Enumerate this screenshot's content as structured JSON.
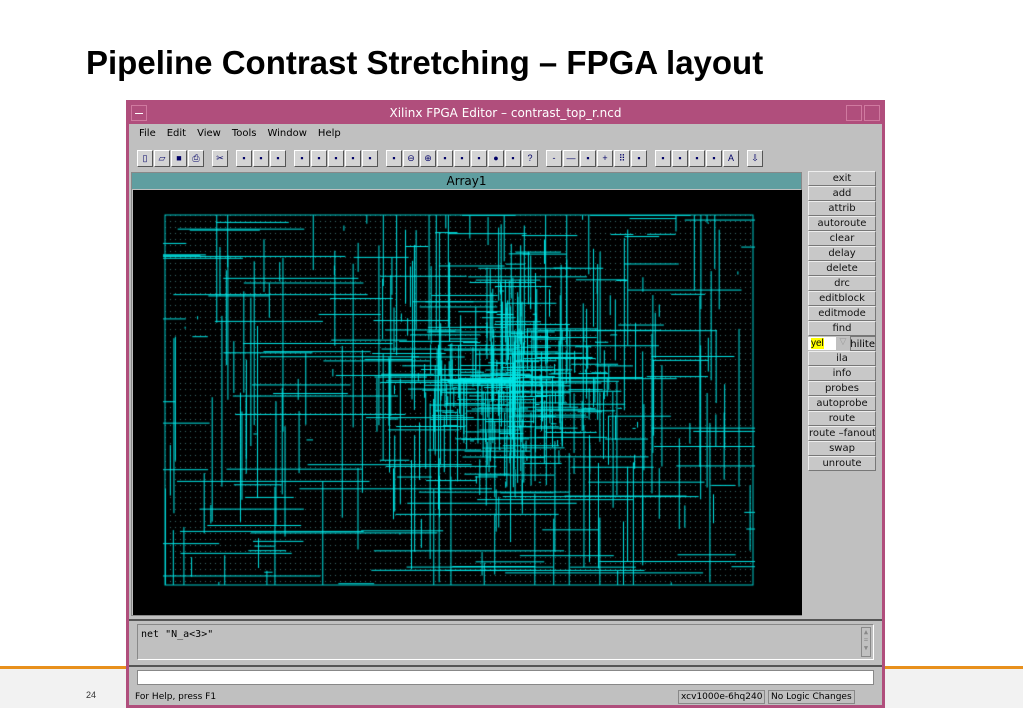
{
  "slide": {
    "title": "Pipeline Contrast Stretching – FPGA layout",
    "page_number": "24"
  },
  "window": {
    "title": "Xilinx FPGA Editor – contrast_top_r.ncd"
  },
  "menu": [
    "File",
    "Edit",
    "View",
    "Tools",
    "Window",
    "Help"
  ],
  "toolbar": [
    [
      "new-icon",
      "open-icon",
      "save-icon",
      "print-icon"
    ],
    [
      "cut-icon"
    ],
    [
      "list-icon",
      "list2-icon",
      "properties-icon"
    ],
    [
      "array-icon",
      "list-view-icon",
      "table-icon",
      "grid-icon",
      "copy-icon"
    ],
    [
      "zoom-fit-icon",
      "zoom-out-icon",
      "zoom-in-icon",
      "zoom-area-icon",
      "zoom-select-icon",
      "refresh-icon",
      "stop-icon",
      "tool-icon",
      "help-icon"
    ],
    [
      "minus-icon",
      "line-icon",
      "bracket-icon",
      "pin-icon",
      "grid-toggle-icon",
      "component-icon"
    ],
    [
      "net-icon",
      "hierarchy-icon",
      "crossing-icon",
      "block-icon",
      "text-icon"
    ],
    [
      "download-icon"
    ]
  ],
  "array_window": {
    "title": "Array1"
  },
  "side_buttons_top": [
    "exit",
    "add",
    "attrib",
    "autoroute",
    "clear",
    "delay",
    "delete",
    "drc",
    "editblock",
    "editmode",
    "find"
  ],
  "hilite": {
    "color": "yel",
    "label": "hilite"
  },
  "side_buttons_bottom": [
    "ila",
    "info",
    "probes",
    "autoprobe",
    "route",
    "route –fanout",
    "swap",
    "unroute"
  ],
  "console": {
    "text": "net \"N_a<3>\""
  },
  "command_input": {
    "value": ""
  },
  "status": {
    "help": "For Help, press F1",
    "device": "xcv1000e-6hq240",
    "changes": "No Logic Changes"
  },
  "colors": {
    "title_bar": "#b04e7c",
    "child_title": "#5f9ea0",
    "route": "#00e5e5",
    "accent": "#e8901c"
  }
}
